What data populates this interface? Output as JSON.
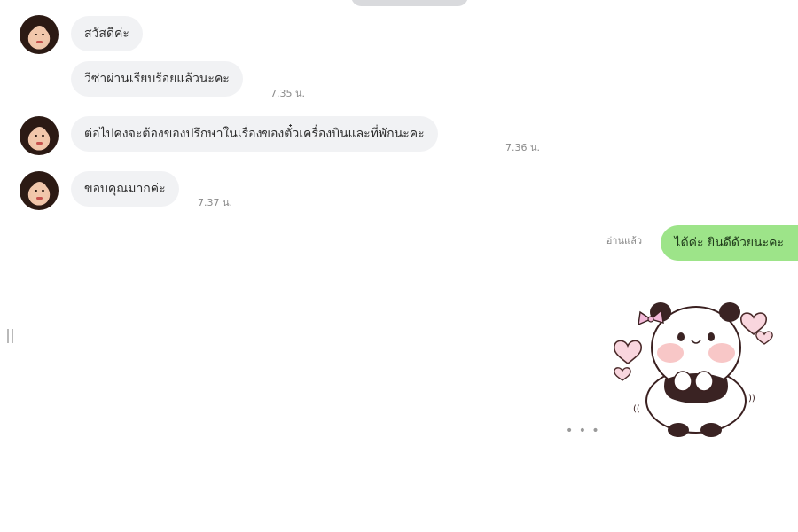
{
  "messages": [
    {
      "text": "สวัสดีค่ะ",
      "time": ""
    },
    {
      "text": "วีซ่าผ่านเรียบร้อยแล้วนะคะ",
      "time": "7.35 น."
    },
    {
      "text": "ต่อไปคงจะต้องของปรึกษาในเรื่องของตั๋วเครื่องบินและที่พักนะคะ",
      "time": "7.36 น."
    },
    {
      "text": "ขอบคุณมากค่ะ",
      "time": "7.37 น."
    }
  ],
  "outgoing": {
    "text": "ได้ค่ะ ยินดีด้วยนะคะ",
    "read_label": "อ่านแล้ว"
  },
  "sticker": {
    "name": "panda-sticker",
    "icon": "panda-hearts"
  },
  "typing_indicator": "• • •",
  "colors": {
    "incoming_bubble": "#f1f2f4",
    "outgoing_bubble": "#9de489",
    "timestamp": "#8a8a8a"
  }
}
